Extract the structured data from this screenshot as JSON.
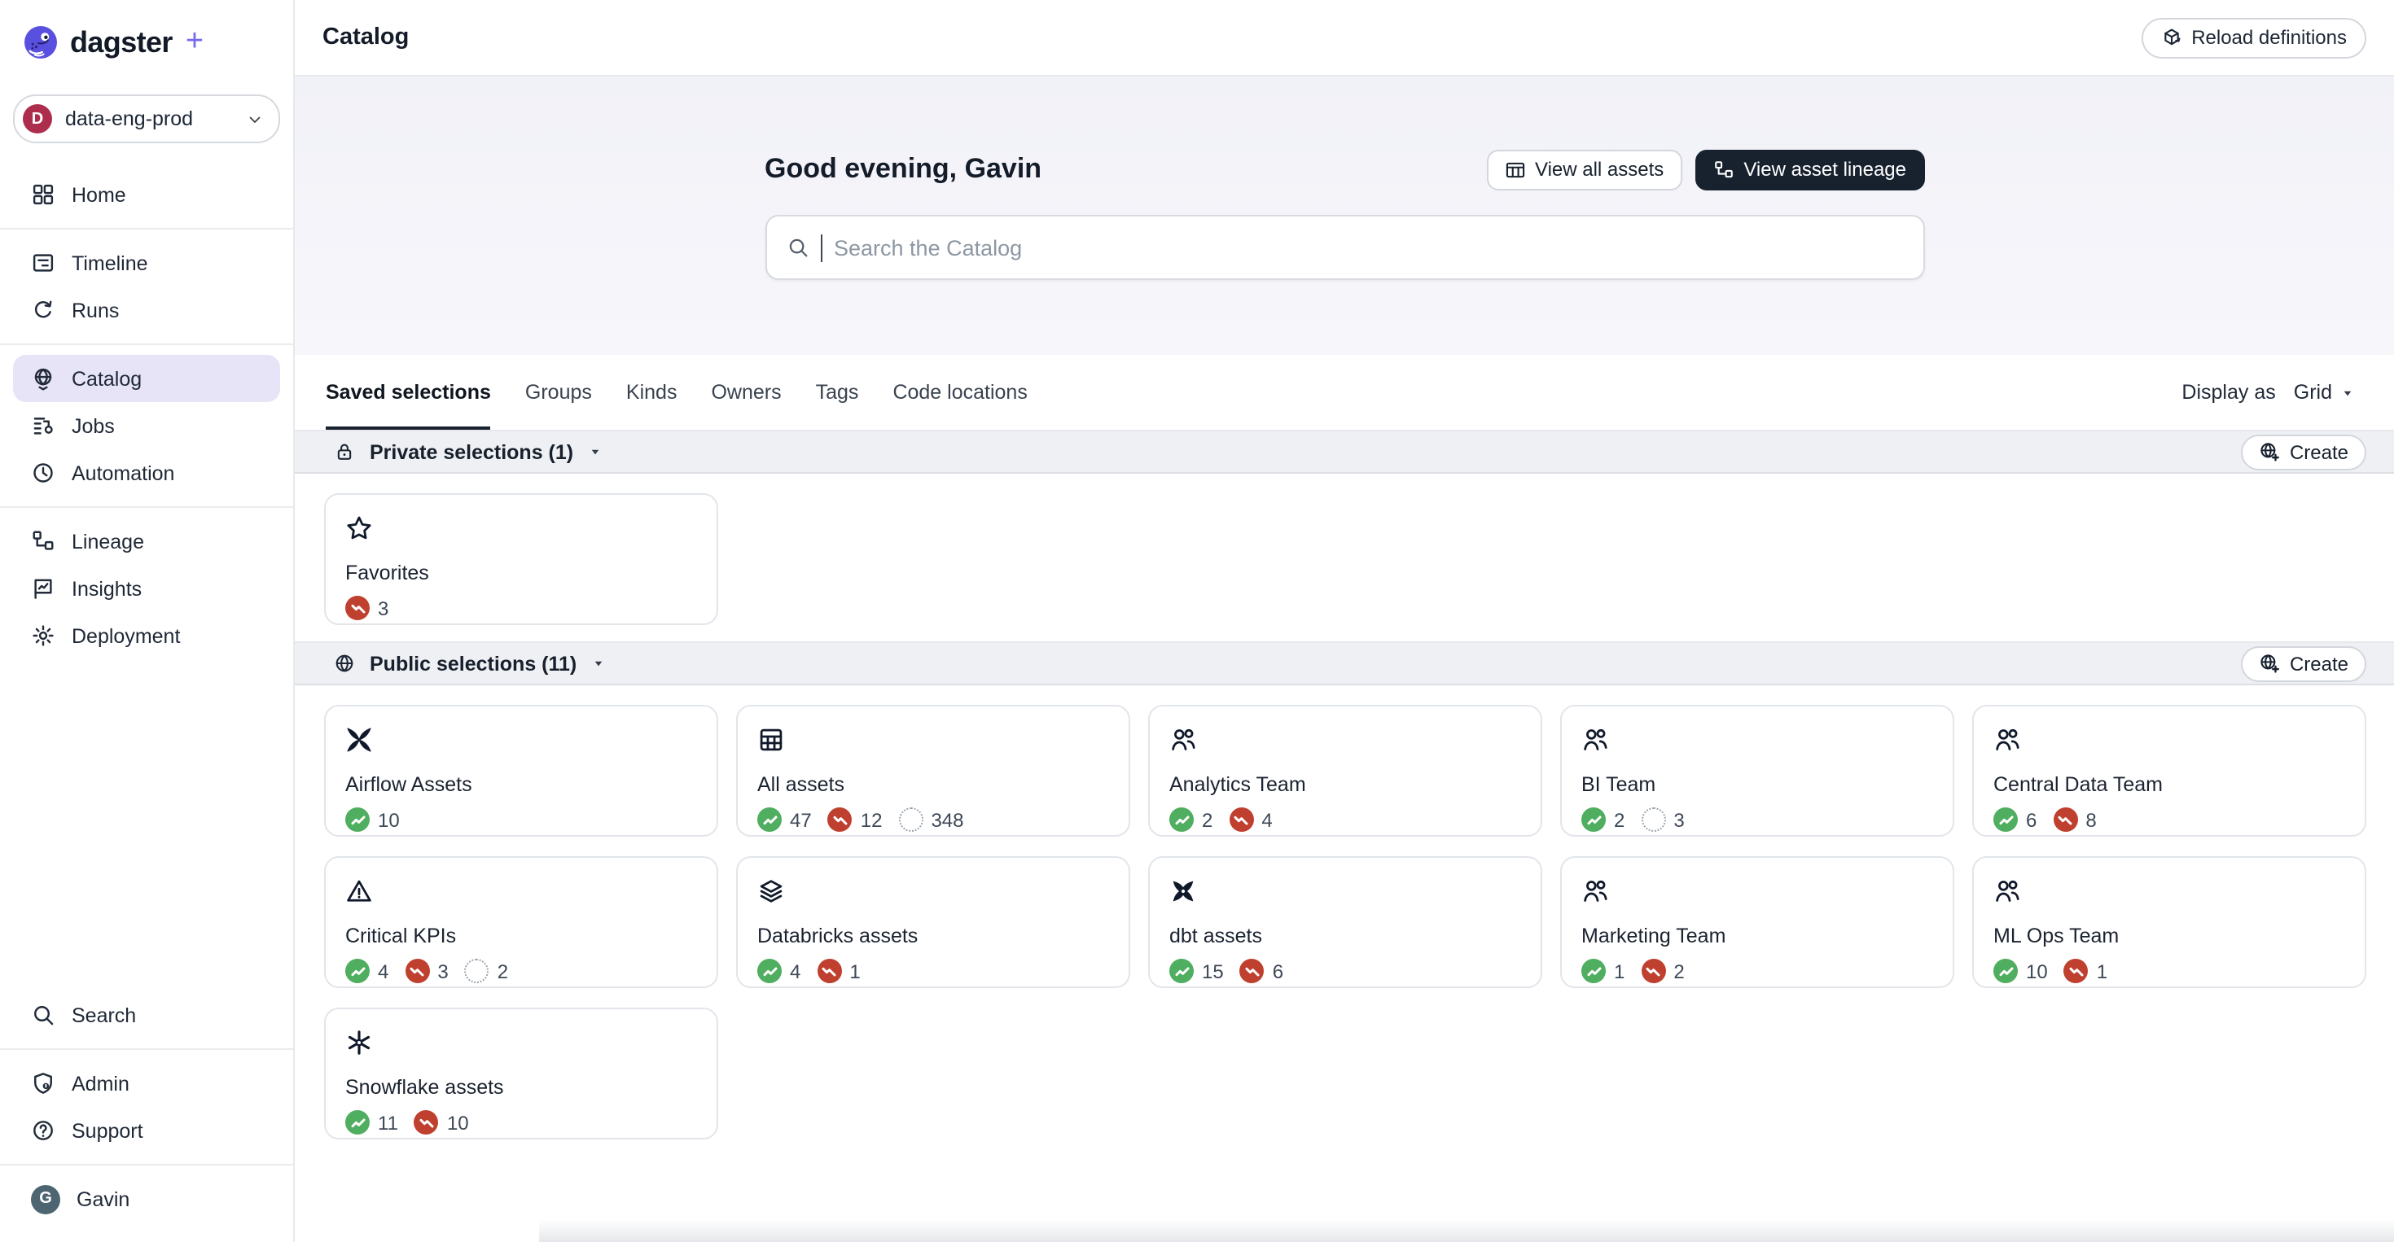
{
  "app": {
    "brand": "dagster",
    "brand_plus": "+",
    "workspace": {
      "initial": "D",
      "name": "data-eng-prod"
    }
  },
  "sidebar": {
    "nav": [
      {
        "label": "Home",
        "icon": "home-icon"
      },
      {
        "divider": true
      },
      {
        "label": "Timeline",
        "icon": "timeline-icon"
      },
      {
        "label": "Runs",
        "icon": "runs-icon"
      },
      {
        "divider": true
      },
      {
        "label": "Catalog",
        "icon": "catalog-icon",
        "active": true
      },
      {
        "label": "Jobs",
        "icon": "jobs-icon"
      },
      {
        "label": "Automation",
        "icon": "automation-icon"
      },
      {
        "divider": true
      },
      {
        "label": "Lineage",
        "icon": "lineage-icon"
      },
      {
        "label": "Insights",
        "icon": "insights-icon"
      },
      {
        "label": "Deployment",
        "icon": "deployment-icon"
      }
    ],
    "footer": [
      {
        "label": "Search",
        "icon": "search-icon"
      },
      {
        "divider": true
      },
      {
        "label": "Admin",
        "icon": "admin-icon"
      },
      {
        "label": "Support",
        "icon": "support-icon"
      }
    ],
    "user": {
      "initial": "G",
      "name": "Gavin"
    }
  },
  "header": {
    "title": "Catalog",
    "reload_label": "Reload definitions"
  },
  "hero": {
    "greeting": "Good evening, Gavin",
    "view_all_label": "View all assets",
    "view_lineage_label": "View asset lineage",
    "search_placeholder": "Search the Catalog"
  },
  "tabs": [
    {
      "label": "Saved selections",
      "active": true
    },
    {
      "label": "Groups"
    },
    {
      "label": "Kinds"
    },
    {
      "label": "Owners"
    },
    {
      "label": "Tags"
    },
    {
      "label": "Code locations"
    }
  ],
  "toolbar": {
    "display_as_label": "Display as",
    "display_as_value": "Grid"
  },
  "sections": [
    {
      "title": "Private selections (1)",
      "icon": "lock-icon",
      "create_label": "Create",
      "cards": [
        {
          "title": "Favorites",
          "icon": "star-icon",
          "counts": [
            {
              "status": "failed",
              "value": "3"
            }
          ]
        }
      ]
    },
    {
      "title": "Public selections (11)",
      "icon": "globe-icon",
      "create_label": "Create",
      "cards": [
        {
          "title": "Airflow Assets",
          "icon": "airflow-icon",
          "counts": [
            {
              "status": "materialized",
              "value": "10"
            }
          ]
        },
        {
          "title": "All assets",
          "icon": "table-grid-icon",
          "counts": [
            {
              "status": "materialized",
              "value": "47"
            },
            {
              "status": "failed",
              "value": "12"
            },
            {
              "status": "missing",
              "value": "348"
            }
          ]
        },
        {
          "title": "Analytics Team",
          "icon": "people-icon",
          "counts": [
            {
              "status": "materialized",
              "value": "2"
            },
            {
              "status": "failed",
              "value": "4"
            }
          ]
        },
        {
          "title": "BI Team",
          "icon": "people-icon",
          "counts": [
            {
              "status": "materialized",
              "value": "2"
            },
            {
              "status": "missing",
              "value": "3"
            }
          ]
        },
        {
          "title": "Central Data Team",
          "icon": "people-icon",
          "counts": [
            {
              "status": "materialized",
              "value": "6"
            },
            {
              "status": "failed",
              "value": "8"
            }
          ]
        },
        {
          "title": "Critical KPIs",
          "icon": "warning-icon",
          "counts": [
            {
              "status": "materialized",
              "value": "4"
            },
            {
              "status": "failed",
              "value": "3"
            },
            {
              "status": "missing",
              "value": "2"
            }
          ]
        },
        {
          "title": "Databricks assets",
          "icon": "layers-icon",
          "counts": [
            {
              "status": "materialized",
              "value": "4"
            },
            {
              "status": "failed",
              "value": "1"
            }
          ]
        },
        {
          "title": "dbt assets",
          "icon": "dbt-icon",
          "counts": [
            {
              "status": "materialized",
              "value": "15"
            },
            {
              "status": "failed",
              "value": "6"
            }
          ]
        },
        {
          "title": "Marketing Team",
          "icon": "people-icon",
          "counts": [
            {
              "status": "materialized",
              "value": "1"
            },
            {
              "status": "failed",
              "value": "2"
            }
          ]
        },
        {
          "title": "ML Ops Team",
          "icon": "people-icon",
          "counts": [
            {
              "status": "materialized",
              "value": "10"
            },
            {
              "status": "failed",
              "value": "1"
            }
          ]
        },
        {
          "title": "Snowflake assets",
          "icon": "snowflake-icon",
          "counts": [
            {
              "status": "materialized",
              "value": "11"
            },
            {
              "status": "failed",
              "value": "10"
            }
          ]
        }
      ]
    }
  ],
  "colors": {
    "accent": "#7468f0",
    "active_nav_bg": "#e7e4f7",
    "success": "#4fae5f",
    "failure": "#c0402f",
    "missing": "#98a1ab",
    "dark_button_bg": "#18222f",
    "workspace_avatar_bg": "#ad2d4c",
    "user_avatar_bg": "#4c6570"
  }
}
